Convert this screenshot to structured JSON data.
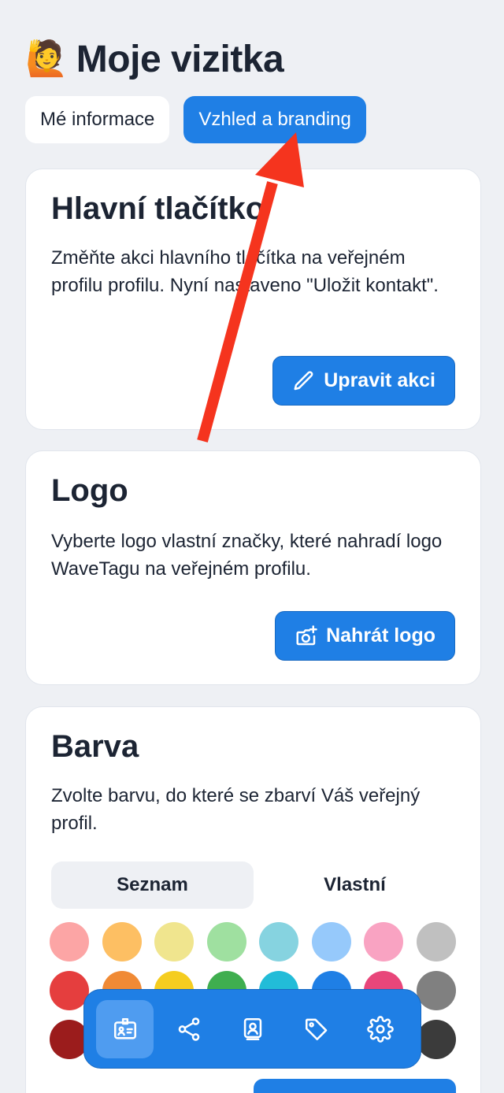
{
  "header": {
    "emoji": "🙋",
    "title": "Moje vizitka"
  },
  "tabs": [
    {
      "label": "Mé informace",
      "active": false
    },
    {
      "label": "Vzhled a branding",
      "active": true
    }
  ],
  "main_button_card": {
    "title": "Hlavní tlačítko",
    "description": "Změňte akci hlavního tlačítka na veřejném profilu profilu. Nyní nastaveno \"Uložit kontakt\".",
    "button_label": "Upravit akci",
    "button_icon": "pencil-icon"
  },
  "logo_card": {
    "title": "Logo",
    "description": "Vyberte logo vlastní značky, které nahradí logo WaveTagu na veřejném profilu.",
    "button_label": "Nahrát logo",
    "button_icon": "camera-plus-icon"
  },
  "color_card": {
    "title": "Barva",
    "description": "Zvolte barvu, do které se zbarví Váš veřejný profil.",
    "segment": [
      {
        "label": "Seznam",
        "selected": true
      },
      {
        "label": "Vlastní",
        "selected": false
      }
    ],
    "swatch_rows": [
      [
        "#fca5a5",
        "#fdbf63",
        "#f0e58e",
        "#9fe0a0",
        "#86d3e0",
        "#96c9fb",
        "#f9a3c2",
        "#c0c0c0"
      ],
      [
        "#e53e3e",
        "#f08a35",
        "#f5cd1f",
        "#3fae4f",
        "#22bcd8",
        "#1f7fe5",
        "#e8467a",
        "#808080"
      ],
      [
        "#9b1c1c",
        "#c2561a",
        "#c29a12",
        "#1d7a30",
        "#137c95",
        "#1552a3",
        "#a3174d",
        "#3b3b3b"
      ]
    ]
  },
  "bottom_nav": {
    "items": [
      {
        "icon": "contact-card-icon",
        "active": true
      },
      {
        "icon": "share-icon",
        "active": false
      },
      {
        "icon": "profile-frame-icon",
        "active": false
      },
      {
        "icon": "tag-icon",
        "active": false
      },
      {
        "icon": "gear-icon",
        "active": false
      }
    ]
  },
  "colors": {
    "accent": "#1f7fe5",
    "background": "#eef0f4",
    "annotation_arrow": "#f5341e"
  }
}
